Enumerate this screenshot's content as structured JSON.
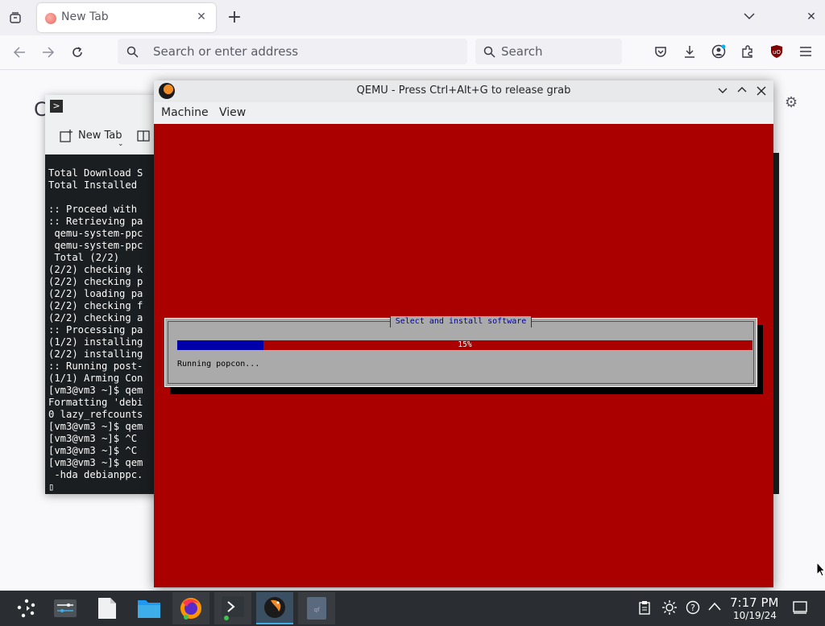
{
  "browser": {
    "tab": {
      "label": "New Tab",
      "close": "✕"
    },
    "new_tab_button": "+",
    "tab_overflow": "⌄",
    "window_close": "✕",
    "url_placeholder": "Search or enter address",
    "search_placeholder": "Search"
  },
  "konsole": {
    "toolbar_new_tab": "New Tab",
    "terminal_lines": [
      "Total Download S",
      "Total Installed ",
      "",
      ":: Proceed with ",
      ":: Retrieving pa",
      " qemu-system-ppc",
      " qemu-system-ppc",
      " Total (2/2)",
      "(2/2) checking k",
      "(2/2) checking p",
      "(2/2) loading pa",
      "(2/2) checking f",
      "(2/2) checking a",
      ":: Processing pa",
      "(1/2) installing",
      "(2/2) installing",
      ":: Running post-",
      "(1/1) Arming Con",
      "[vm3@vm3 ~]$ qem",
      "Formatting 'debi",
      "0 lazy_refcounts",
      "[vm3@vm3 ~]$ qem",
      "[vm3@vm3 ~]$ ^C",
      "[vm3@vm3 ~]$ ^C",
      "[vm3@vm3 ~]$ qem",
      " -hda debianppc.",
      "▯"
    ]
  },
  "qemu": {
    "title": "QEMU - Press Ctrl+Alt+G to release grab",
    "menu": [
      "Machine",
      "View"
    ],
    "dialog": {
      "title": "Select and install software",
      "progress_percent": 15,
      "progress_label": "15%",
      "status": "Running popcon..."
    },
    "colors": {
      "screen_bg": "#aa0000",
      "dialog_bg": "#aaaaaa",
      "progress_fill": "#0000aa"
    }
  },
  "taskbar": {
    "clock_time": "7:17 PM",
    "clock_date": "10/19/24",
    "apps": [
      "application-launcher-icon",
      "task-manager-icon",
      "files-icon",
      "folder-icon",
      "firefox-icon",
      "konsole-icon",
      "qemu-icon",
      "thumbnail-icon"
    ]
  },
  "colors": {
    "taskbar_bg": "#2a2e32",
    "accent": "#3daee9"
  }
}
